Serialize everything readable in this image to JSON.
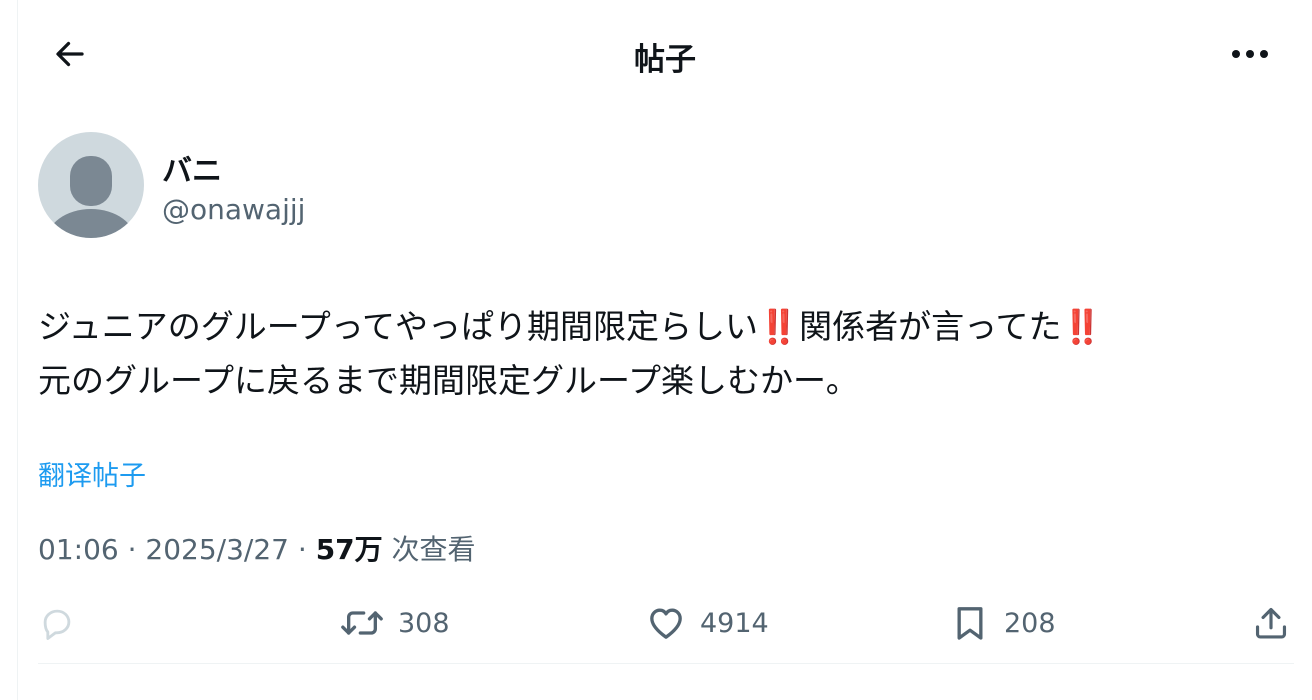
{
  "header": {
    "title": "帖子",
    "back_icon": "arrow-left-icon",
    "more_icon": "more-horizontal-icon"
  },
  "author": {
    "display_name": "バニ",
    "handle": "@onawajjj",
    "avatar_icon": "default-avatar-icon"
  },
  "tweet": {
    "part1": "ジュニアのグループってやっぱり期間限定らしい",
    "bang1": "‼️",
    "part2": "関係者が言ってた",
    "bang2": "‼️",
    "part3": "\n元のグループに戻るまで期間限定グループ楽しむかー。"
  },
  "translate_label": "翻译帖子",
  "meta": {
    "time": "01:06",
    "sep1": " · ",
    "date": "2025/3/27",
    "sep2": " · ",
    "views_count": "57万",
    "views_label": " 次查看"
  },
  "actions": {
    "reply": {
      "icon": "reply-icon",
      "count": ""
    },
    "retweet": {
      "icon": "retweet-icon",
      "count": "308"
    },
    "like": {
      "icon": "heart-icon",
      "count": "4914"
    },
    "bookmark": {
      "icon": "bookmark-icon",
      "count": "208"
    },
    "share": {
      "icon": "share-icon"
    }
  },
  "colors": {
    "text": "#0f1419",
    "secondary": "#536471",
    "link": "#1d9bf0",
    "emoji_red": "#e0232e",
    "reply_icon": "#cfd9de",
    "avatar_bg": "#cfd9de",
    "avatar_fg": "#7b8893"
  }
}
